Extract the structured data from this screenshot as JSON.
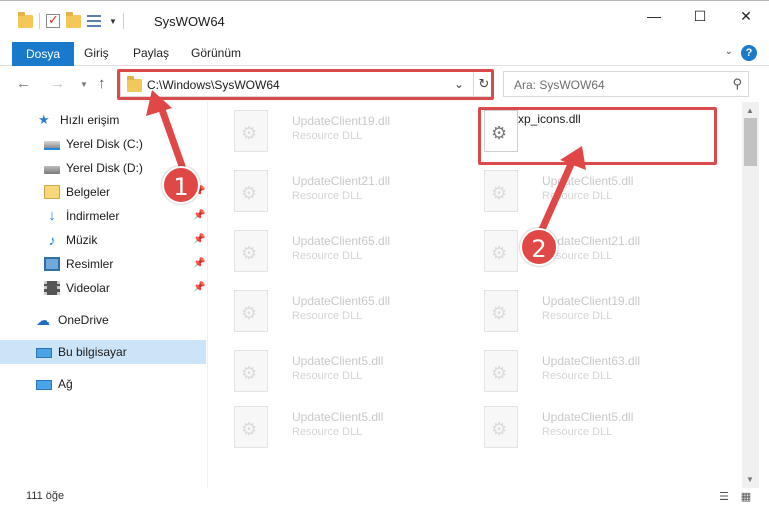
{
  "window": {
    "title": "SysWOW64",
    "minimize_icon": "minimize-icon",
    "maximize_icon": "maximize-icon",
    "close_icon": "close-icon"
  },
  "ribbon": {
    "tabs": [
      {
        "label": "Dosya",
        "active": true
      },
      {
        "label": "Giriş",
        "active": false
      },
      {
        "label": "Paylaş",
        "active": false
      },
      {
        "label": "Görünüm",
        "active": false
      }
    ],
    "help_label": "?"
  },
  "address": {
    "path": "C:\\Windows\\SysWOW64",
    "search_placeholder": "Ara: SysWOW64"
  },
  "sidebar": {
    "items": [
      {
        "label": "Hızlı erişim"
      },
      {
        "label": "Yerel Disk (C:)"
      },
      {
        "label": "Yerel Disk (D:)"
      },
      {
        "label": "Belgeler"
      },
      {
        "label": "İndirmeler"
      },
      {
        "label": "Müzik"
      },
      {
        "label": "Resimler"
      },
      {
        "label": "Videolar"
      },
      {
        "label": "OneDrive"
      },
      {
        "label": "Bu bilgisayar"
      },
      {
        "label": "Ağ"
      }
    ]
  },
  "files": [
    {
      "name": "UpdateClient19.dll",
      "type": "Resource DLL"
    },
    {
      "name": "xp_icons.dll",
      "type": ""
    },
    {
      "name": "UpdateClient21.dll",
      "type": "Resource DLL"
    },
    {
      "name": "UpdateClient5.dll",
      "type": "Resource DLL"
    },
    {
      "name": "UpdateClient65.dll",
      "type": "Resource DLL"
    },
    {
      "name": "UpdateClient21.dll",
      "type": "Resource DLL"
    },
    {
      "name": "UpdateClient65.dll",
      "type": "Resource DLL"
    },
    {
      "name": "UpdateClient19.dll",
      "type": "Resource DLL"
    },
    {
      "name": "UpdateClient5.dll",
      "type": "Resource DLL"
    },
    {
      "name": "UpdateClient63.dll",
      "type": "Resource DLL"
    },
    {
      "name": "UpdateClient5.dll",
      "type": "Resource DLL"
    },
    {
      "name": "UpdateClient5.dll",
      "type": "Resource DLL"
    }
  ],
  "status": {
    "item_count": "111 öğe"
  },
  "annotations": {
    "step1": "1",
    "step2": "2",
    "color": "#e04848"
  }
}
